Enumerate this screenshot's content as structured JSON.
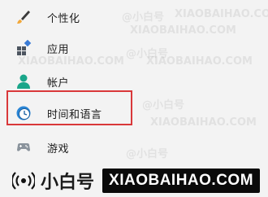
{
  "nav": {
    "items": [
      {
        "label": "个性化",
        "icon": "brush-icon"
      },
      {
        "label": "应用",
        "icon": "apps-icon"
      },
      {
        "label": "帐户",
        "icon": "person-icon"
      },
      {
        "label": "时间和语言",
        "icon": "clock-globe-icon"
      },
      {
        "label": "游戏",
        "icon": "gamepad-icon"
      }
    ],
    "highlight_color": "#d9383a"
  },
  "watermark": {
    "text": "XIAOBAIHAO.COM",
    "handle": "@小白号"
  },
  "brand": {
    "name": "小白号",
    "url": "XIAOBAIHAO.COM"
  }
}
